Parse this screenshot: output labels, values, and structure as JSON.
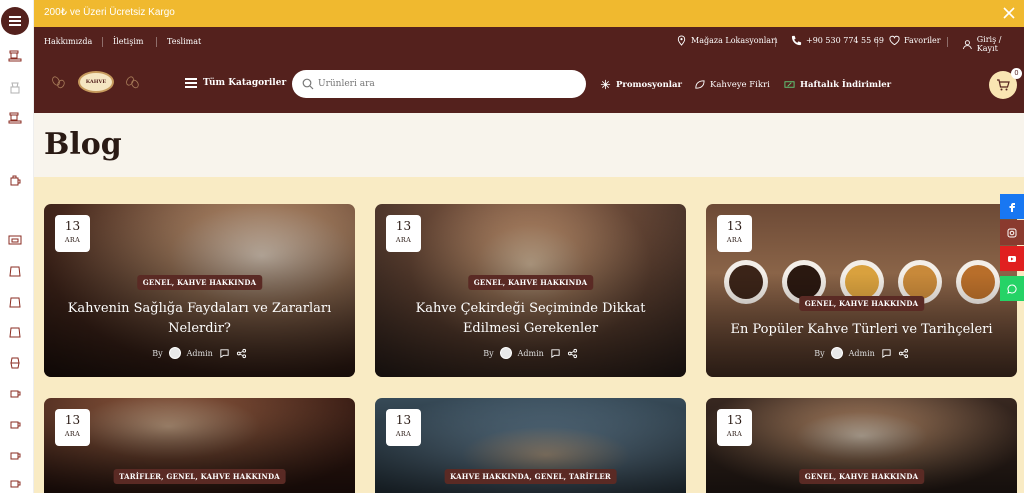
{
  "banner": {
    "text": "200₺ ve Üzeri Ücretsiz Kargo"
  },
  "topnav": {
    "about": "Hakkımızda",
    "contact": "İletişim",
    "delivery": "Teslimat"
  },
  "utility": {
    "store": "Mağaza Lokasyonları",
    "phone": "+90 530 774 55 69",
    "favorites": "Favoriler",
    "login": "Giriş / Kayıt"
  },
  "logo": {
    "text": "KAHVE"
  },
  "nav": {
    "all_categories": "Tüm Katagoriler",
    "search_placeholder": "Ürünleri ara",
    "promotions": "Promosyonlar",
    "coffee_idea": "Kahveye Fikri",
    "weekly_deals": "Haftalık İndirimler",
    "cart_count": "0"
  },
  "page": {
    "title": "Blog"
  },
  "cards": [
    {
      "day": "13",
      "month": "ARA",
      "tags": "GENEL, KAHVE HAKKINDA",
      "title": "Kahvenin Sağlığa Faydaları ve Zararları Nelerdir?",
      "by": "By",
      "author": "Admin"
    },
    {
      "day": "13",
      "month": "ARA",
      "tags": "GENEL, KAHVE HAKKINDA",
      "title": "Kahve Çekirdeği Seçiminde Dikkat Edilmesi Gerekenler",
      "by": "By",
      "author": "Admin"
    },
    {
      "day": "13",
      "month": "ARA",
      "tags": "GENEL, KAHVE HAKKINDA",
      "title": "En Popüler Kahve Türleri ve Tarihçeleri",
      "by": "By",
      "author": "Admin"
    },
    {
      "day": "13",
      "month": "ARA",
      "tags": "TARİFLER, GENEL, KAHVE HAKKINDA"
    },
    {
      "day": "13",
      "month": "ARA",
      "tags": "KAHVE HAKKINDA, GENEL, TARİFLER"
    },
    {
      "day": "13",
      "month": "ARA",
      "tags": "GENEL, KAHVE HAKKINDA"
    }
  ],
  "colors": {
    "brand": "#54211d",
    "banner": "#f0b92f",
    "page_bg": "#f9ebc4",
    "facebook": "#1877f2",
    "instagram": "#8a3a2e",
    "youtube": "#e02020",
    "whatsapp": "#25d366"
  },
  "icons": [
    "menu-icon",
    "close-icon",
    "map-pin-icon",
    "phone-icon",
    "heart-icon",
    "user-icon",
    "search-icon",
    "sparkle-icon",
    "leaf-icon",
    "discount-icon",
    "cart-icon",
    "comment-icon",
    "share-icon",
    "facebook-icon",
    "instagram-icon",
    "youtube-icon",
    "whatsapp-icon"
  ]
}
